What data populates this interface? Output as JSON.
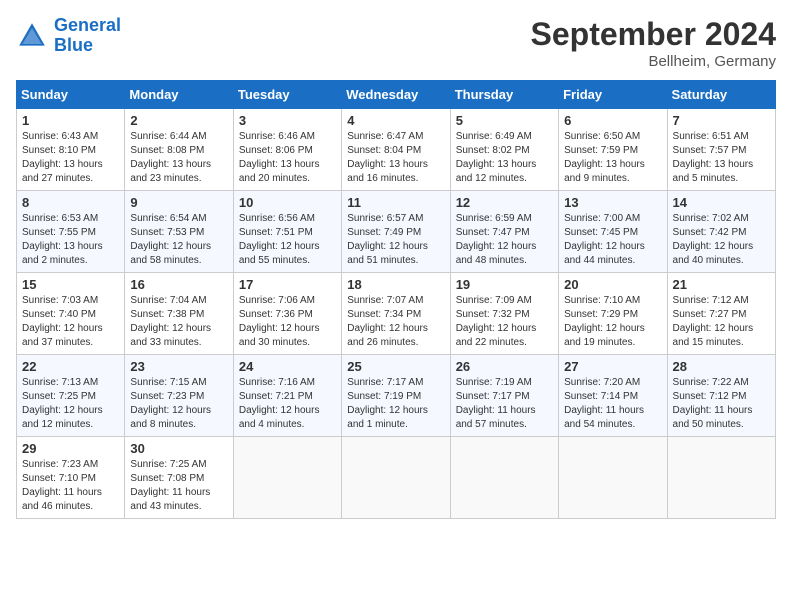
{
  "header": {
    "logo_line1": "General",
    "logo_line2": "Blue",
    "month": "September 2024",
    "location": "Bellheim, Germany"
  },
  "columns": [
    "Sunday",
    "Monday",
    "Tuesday",
    "Wednesday",
    "Thursday",
    "Friday",
    "Saturday"
  ],
  "weeks": [
    [
      {
        "day": "1",
        "lines": [
          "Sunrise: 6:43 AM",
          "Sunset: 8:10 PM",
          "Daylight: 13 hours",
          "and 27 minutes."
        ]
      },
      {
        "day": "2",
        "lines": [
          "Sunrise: 6:44 AM",
          "Sunset: 8:08 PM",
          "Daylight: 13 hours",
          "and 23 minutes."
        ]
      },
      {
        "day": "3",
        "lines": [
          "Sunrise: 6:46 AM",
          "Sunset: 8:06 PM",
          "Daylight: 13 hours",
          "and 20 minutes."
        ]
      },
      {
        "day": "4",
        "lines": [
          "Sunrise: 6:47 AM",
          "Sunset: 8:04 PM",
          "Daylight: 13 hours",
          "and 16 minutes."
        ]
      },
      {
        "day": "5",
        "lines": [
          "Sunrise: 6:49 AM",
          "Sunset: 8:02 PM",
          "Daylight: 13 hours",
          "and 12 minutes."
        ]
      },
      {
        "day": "6",
        "lines": [
          "Sunrise: 6:50 AM",
          "Sunset: 7:59 PM",
          "Daylight: 13 hours",
          "and 9 minutes."
        ]
      },
      {
        "day": "7",
        "lines": [
          "Sunrise: 6:51 AM",
          "Sunset: 7:57 PM",
          "Daylight: 13 hours",
          "and 5 minutes."
        ]
      }
    ],
    [
      {
        "day": "8",
        "lines": [
          "Sunrise: 6:53 AM",
          "Sunset: 7:55 PM",
          "Daylight: 13 hours",
          "and 2 minutes."
        ]
      },
      {
        "day": "9",
        "lines": [
          "Sunrise: 6:54 AM",
          "Sunset: 7:53 PM",
          "Daylight: 12 hours",
          "and 58 minutes."
        ]
      },
      {
        "day": "10",
        "lines": [
          "Sunrise: 6:56 AM",
          "Sunset: 7:51 PM",
          "Daylight: 12 hours",
          "and 55 minutes."
        ]
      },
      {
        "day": "11",
        "lines": [
          "Sunrise: 6:57 AM",
          "Sunset: 7:49 PM",
          "Daylight: 12 hours",
          "and 51 minutes."
        ]
      },
      {
        "day": "12",
        "lines": [
          "Sunrise: 6:59 AM",
          "Sunset: 7:47 PM",
          "Daylight: 12 hours",
          "and 48 minutes."
        ]
      },
      {
        "day": "13",
        "lines": [
          "Sunrise: 7:00 AM",
          "Sunset: 7:45 PM",
          "Daylight: 12 hours",
          "and 44 minutes."
        ]
      },
      {
        "day": "14",
        "lines": [
          "Sunrise: 7:02 AM",
          "Sunset: 7:42 PM",
          "Daylight: 12 hours",
          "and 40 minutes."
        ]
      }
    ],
    [
      {
        "day": "15",
        "lines": [
          "Sunrise: 7:03 AM",
          "Sunset: 7:40 PM",
          "Daylight: 12 hours",
          "and 37 minutes."
        ]
      },
      {
        "day": "16",
        "lines": [
          "Sunrise: 7:04 AM",
          "Sunset: 7:38 PM",
          "Daylight: 12 hours",
          "and 33 minutes."
        ]
      },
      {
        "day": "17",
        "lines": [
          "Sunrise: 7:06 AM",
          "Sunset: 7:36 PM",
          "Daylight: 12 hours",
          "and 30 minutes."
        ]
      },
      {
        "day": "18",
        "lines": [
          "Sunrise: 7:07 AM",
          "Sunset: 7:34 PM",
          "Daylight: 12 hours",
          "and 26 minutes."
        ]
      },
      {
        "day": "19",
        "lines": [
          "Sunrise: 7:09 AM",
          "Sunset: 7:32 PM",
          "Daylight: 12 hours",
          "and 22 minutes."
        ]
      },
      {
        "day": "20",
        "lines": [
          "Sunrise: 7:10 AM",
          "Sunset: 7:29 PM",
          "Daylight: 12 hours",
          "and 19 minutes."
        ]
      },
      {
        "day": "21",
        "lines": [
          "Sunrise: 7:12 AM",
          "Sunset: 7:27 PM",
          "Daylight: 12 hours",
          "and 15 minutes."
        ]
      }
    ],
    [
      {
        "day": "22",
        "lines": [
          "Sunrise: 7:13 AM",
          "Sunset: 7:25 PM",
          "Daylight: 12 hours",
          "and 12 minutes."
        ]
      },
      {
        "day": "23",
        "lines": [
          "Sunrise: 7:15 AM",
          "Sunset: 7:23 PM",
          "Daylight: 12 hours",
          "and 8 minutes."
        ]
      },
      {
        "day": "24",
        "lines": [
          "Sunrise: 7:16 AM",
          "Sunset: 7:21 PM",
          "Daylight: 12 hours",
          "and 4 minutes."
        ]
      },
      {
        "day": "25",
        "lines": [
          "Sunrise: 7:17 AM",
          "Sunset: 7:19 PM",
          "Daylight: 12 hours",
          "and 1 minute."
        ]
      },
      {
        "day": "26",
        "lines": [
          "Sunrise: 7:19 AM",
          "Sunset: 7:17 PM",
          "Daylight: 11 hours",
          "and 57 minutes."
        ]
      },
      {
        "day": "27",
        "lines": [
          "Sunrise: 7:20 AM",
          "Sunset: 7:14 PM",
          "Daylight: 11 hours",
          "and 54 minutes."
        ]
      },
      {
        "day": "28",
        "lines": [
          "Sunrise: 7:22 AM",
          "Sunset: 7:12 PM",
          "Daylight: 11 hours",
          "and 50 minutes."
        ]
      }
    ],
    [
      {
        "day": "29",
        "lines": [
          "Sunrise: 7:23 AM",
          "Sunset: 7:10 PM",
          "Daylight: 11 hours",
          "and 46 minutes."
        ]
      },
      {
        "day": "30",
        "lines": [
          "Sunrise: 7:25 AM",
          "Sunset: 7:08 PM",
          "Daylight: 11 hours",
          "and 43 minutes."
        ]
      },
      {
        "day": "",
        "lines": []
      },
      {
        "day": "",
        "lines": []
      },
      {
        "day": "",
        "lines": []
      },
      {
        "day": "",
        "lines": []
      },
      {
        "day": "",
        "lines": []
      }
    ]
  ]
}
